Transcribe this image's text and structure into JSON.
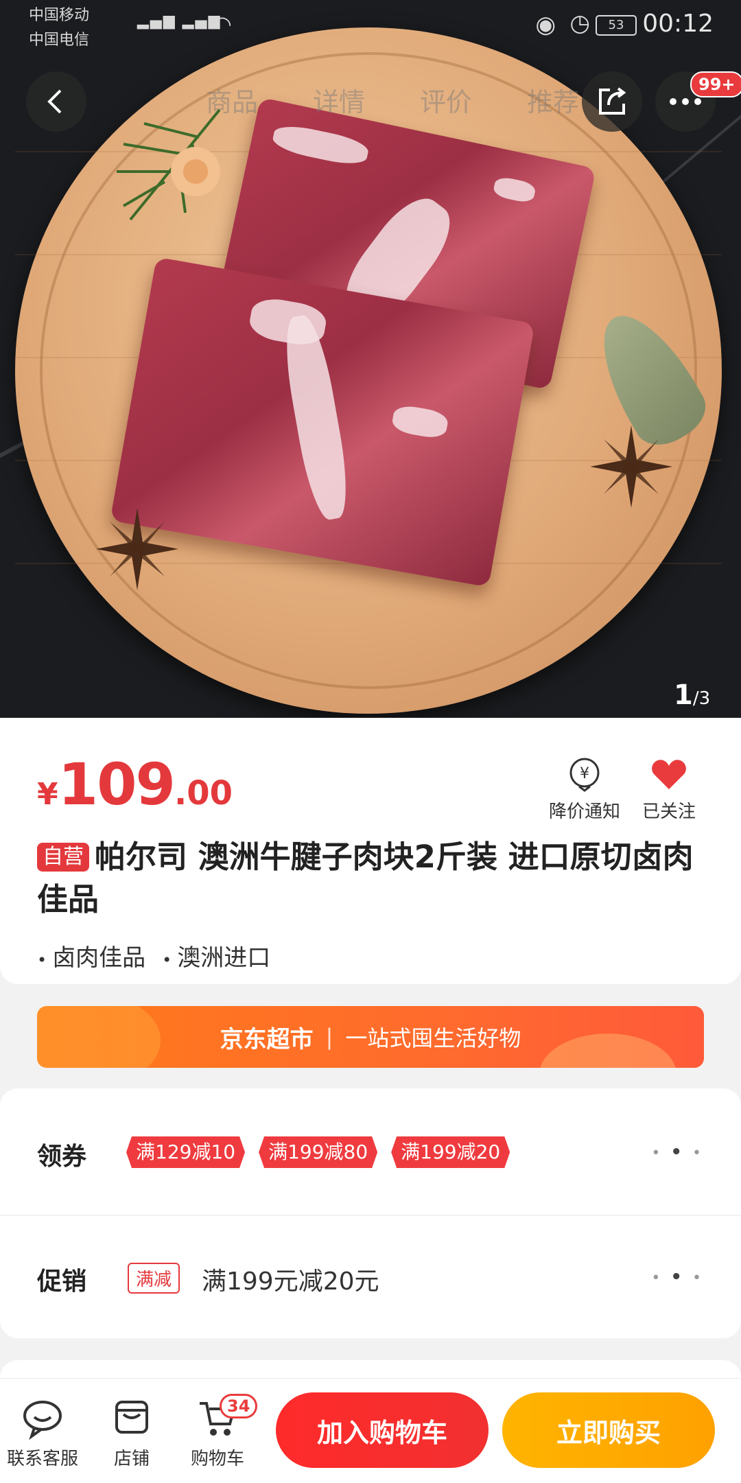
{
  "status": {
    "carrier1": "中国移动",
    "carrier2": "中国电信",
    "battery": "53",
    "time": "00:12"
  },
  "nav": {
    "tabs": [
      "商品",
      "详情",
      "评价",
      "推荐"
    ],
    "more_badge": "99+"
  },
  "gallery": {
    "current": "1",
    "total": "/3"
  },
  "product": {
    "currency": "¥",
    "price_int": "109",
    "price_dec": ".00",
    "self_tag": "自营",
    "title": "帕尔司 澳洲牛腱子肉块2斤装  进口原切卤肉佳品",
    "tags": [
      "卤肉佳品",
      "澳洲进口"
    ]
  },
  "actions": {
    "notify_label": "降价通知",
    "fav_label": "已关注"
  },
  "banner": {
    "brand": "京东超市",
    "slogan": "一站式囤生活好物"
  },
  "coupon": {
    "label": "领券",
    "items": [
      "满129减10",
      "满199减80",
      "满199减20"
    ]
  },
  "promo": {
    "label": "促销",
    "tag": "满减",
    "text": "满199元减20元"
  },
  "bottom": {
    "service_label": "联系客服",
    "shop_label": "店铺",
    "cart_label": "购物车",
    "cart_count": "34",
    "add_cart": "加入购物车",
    "buy_now": "立即购买"
  },
  "colors": {
    "accent": "#e4393c",
    "buy": "#ffa100",
    "banner": "#ff6b2d"
  }
}
